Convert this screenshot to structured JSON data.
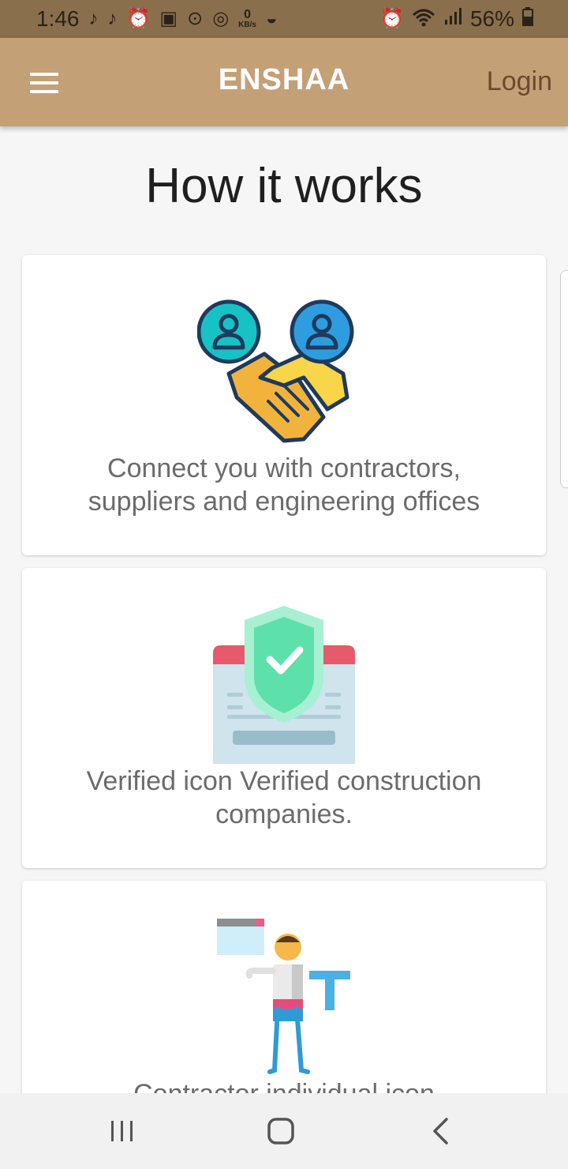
{
  "status_bar": {
    "time": "1:46",
    "left_icons": [
      "music-note-icon",
      "tiktok-icon",
      "alarm-icon",
      "gallery-icon",
      "sync-icon",
      "messenger-icon",
      "data-speed-icon",
      "app-icon"
    ],
    "speed_value": "0",
    "speed_unit": "KB/s",
    "right_icons": [
      "alarm-icon",
      "wifi-icon",
      "signal-icon",
      "battery-icon"
    ],
    "battery": "56%"
  },
  "app_bar": {
    "title": "ENSHAA",
    "login_label": "Login",
    "background": "#c4a077"
  },
  "page": {
    "title": "How it works"
  },
  "cards": [
    {
      "icon": "handshake-icon",
      "text_line1": "Connect you with contractors,",
      "text_line2": "suppliers and engineering offices"
    },
    {
      "icon": "verified-shield-icon",
      "text_line1": "Verified icon Verified construction",
      "text_line2": "companies."
    },
    {
      "icon": "contractor-individual-icon",
      "text_line1": "Contractor individual icon",
      "text_line2": ""
    }
  ],
  "nav_bar": {
    "buttons": [
      "recent-apps-icon",
      "home-icon",
      "back-icon"
    ]
  }
}
